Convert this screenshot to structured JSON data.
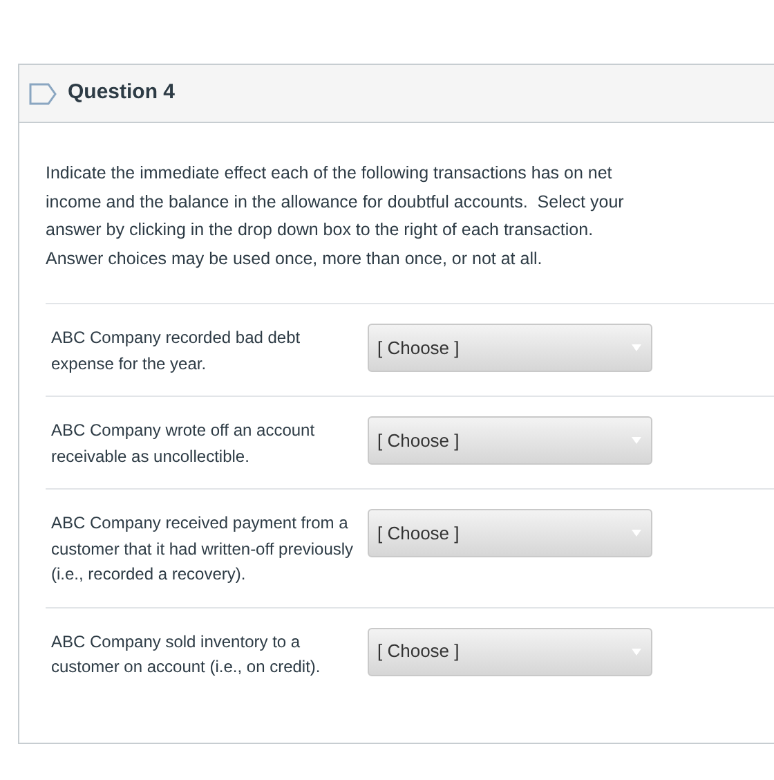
{
  "question": {
    "title": "Question 4",
    "prompt": "Indicate the immediate effect each of the following transactions has on net income and the balance in the allowance for doubtful accounts.  Select your answer by clicking in the drop down box to the right of each transaction.   Answer choices may be used once, more than once, or not at all.",
    "items": [
      {
        "text": "ABC Company recorded bad debt expense for the year.",
        "value": "[ Choose ]"
      },
      {
        "text": "ABC Company wrote off an account receivable as uncollectible.",
        "value": "[ Choose ]"
      },
      {
        "text": "ABC Company received payment from a customer that it had written-off previously (i.e., recorded a recovery).",
        "value": "[ Choose ]"
      },
      {
        "text": "ABC Company sold inventory to a customer on account (i.e., on credit).",
        "value": "[ Choose ]"
      }
    ]
  }
}
